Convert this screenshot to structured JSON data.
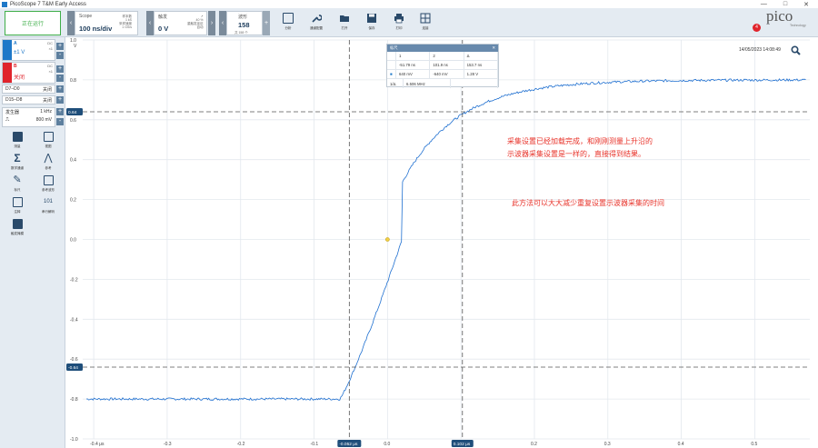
{
  "window": {
    "title": "PicoScope 7 T&M Early Access",
    "controls": [
      "—",
      "□",
      "✕"
    ]
  },
  "toolbar": {
    "run_label": "正在运行",
    "scope": {
      "label": "Scope",
      "value": "100 ns/div",
      "side": [
        "样本数",
        "1 kS",
        "采样速度",
        "1 GS/s"
      ]
    },
    "trigger": {
      "label": "触发",
      "value": "0 V",
      "side": [
        "↗",
        "40 %",
        "重触发延迟",
        "自动"
      ]
    },
    "waveforms": {
      "label": "波形",
      "value": "158",
      "sub": "共 158 个"
    },
    "tools": [
      "分析",
      "通道配置",
      "打开",
      "保存",
      "打印",
      "连接"
    ]
  },
  "sidebar": {
    "channel_a": {
      "name": "A",
      "coupling": "DC",
      "sub": "×1",
      "range": "±1 V",
      "color": "#1e78c8"
    },
    "channel_b": {
      "name": "B",
      "coupling": "DC",
      "sub": "×1",
      "range": "关闭",
      "color": "#e0242c"
    },
    "digital_rows": [
      {
        "label": "D7–D0",
        "state": "关闭"
      },
      {
        "label": "D15–D8",
        "state": "关闭"
      }
    ],
    "generator": {
      "label": "发生器",
      "freq": "1 kHz",
      "amp": "800 mV"
    },
    "tools": [
      "测量",
      "视图",
      "数学通道",
      "参考",
      "标尺",
      "参考波形",
      "注释",
      "串行解码",
      "触发掩模"
    ]
  },
  "plot": {
    "datetime": "14/05/2023 14:08:49",
    "badge": "4",
    "logo_text": "pico",
    "logo_sub": "Technology",
    "y_unit": "V",
    "y_ticks": [
      "1.0",
      "0.8",
      "0.6",
      "0.4",
      "0.2",
      "0.0",
      "-0.2",
      "-0.4",
      "-0.6",
      "-0.8",
      "-1.0"
    ],
    "x_ticks": [
      "-0.4 μs",
      "-0.3",
      "-0.2",
      "-0.1",
      "0.0",
      "0.1",
      "0.2",
      "0.3",
      "0.4",
      "0.5"
    ],
    "cursor_labels": {
      "h_top": "0.64",
      "h_bottom": "-0.64",
      "v_left": "-0.052 μs",
      "v_right": "0.102 μs"
    }
  },
  "ruler_table": {
    "title": "标尺",
    "headers": [
      "",
      "1",
      "2",
      "Δ"
    ],
    "time_row": [
      "",
      "-51.79 ns",
      "101.9 ns",
      "153.7 ns"
    ],
    "volt_row": [
      "■",
      "640 mV",
      "-640 mV",
      "1.28 V"
    ],
    "freq_row": [
      "1/Δ",
      "6.506 MHz",
      ""
    ]
  },
  "notes": {
    "line1": "采集设置已经加载完成，和刚刚测量上升沿的",
    "line2": "示波器采集设置是一样的，直接得到结果。",
    "line3": "此方法可以大大减少重复设置示波器采集的时间"
  },
  "colors": {
    "trace": "#1e6fd0",
    "cursor": "#555555",
    "accent": "#3fae49"
  }
}
